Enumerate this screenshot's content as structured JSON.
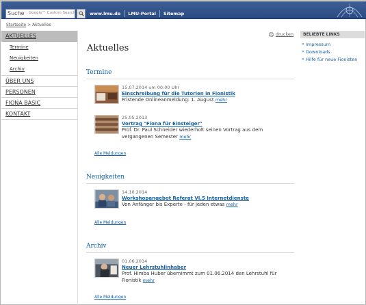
{
  "header": {
    "search_label": "Suche",
    "search_hint": "Google™ Custom Search",
    "search_placeholder": "",
    "links": [
      "www.lmu.de",
      "LMU-Portal",
      "Sitemap"
    ]
  },
  "breadcrumb": {
    "home": "Startseite",
    "separator": ">",
    "current": "Aktuelles"
  },
  "nav": {
    "main_active": "AKTUELLES",
    "subitems": [
      "Termine",
      "Neuigkeiten",
      "Archiv"
    ],
    "main_items": [
      "ÜBER UNS",
      "PERSONEN",
      "FIONA BASIC",
      "KONTAKT"
    ]
  },
  "page": {
    "print_label": "drucken",
    "title": "Aktuelles"
  },
  "sections": [
    {
      "title": "Termine",
      "items": [
        {
          "date": "15.07.2014 um 00:00 Uhr",
          "title": "Einschreibung für die Tutorien in Fionistik",
          "desc": "Fristende Onlineanmeldung: 1. August",
          "more": "mehr"
        },
        {
          "date": "25.05.2013",
          "title": "Vortrag \"Fiona für Einsteiger\"",
          "desc": "Prof. Dr. Paul Schneider wiederholt seinen Vortrag aus dem vergangenen Semester",
          "more": "mehr"
        }
      ],
      "all_label": "Alle Meldungen"
    },
    {
      "title": "Neuigkeiten",
      "items": [
        {
          "date": "14.10.2014",
          "title": "Workshopangebot Referat VI.5 Internetdienste",
          "desc": "Von Anfänger bis Experte - für jeden etwas",
          "more": "mehr"
        }
      ],
      "all_label": "Alle Meldungen"
    },
    {
      "title": "Archiv",
      "items": [
        {
          "date": "01.06.2014",
          "title": "Neuer Lehrstuhlinhaber",
          "desc": "Prof. Himba Huber übernimmt zum 01.06.2014 den Lehrstuhl für Fionistik",
          "more": "mehr"
        }
      ],
      "all_label": "Alle Meldungen"
    }
  ],
  "sidebar_right": {
    "heading": "BELIEBTE LINKS",
    "bullet": "»",
    "links": [
      "Impressum",
      "Downloads",
      "Hilfe für neue Fionisten"
    ]
  },
  "colors": {
    "header_blue": "#2b4c82",
    "link_blue": "#1360a5",
    "section_blue": "#0a5fa3",
    "nav_active": "#bcbcbc"
  },
  "icons": {
    "search": "magnifier-icon",
    "print": "printer-icon",
    "logo": "lmu-seal-logo"
  }
}
